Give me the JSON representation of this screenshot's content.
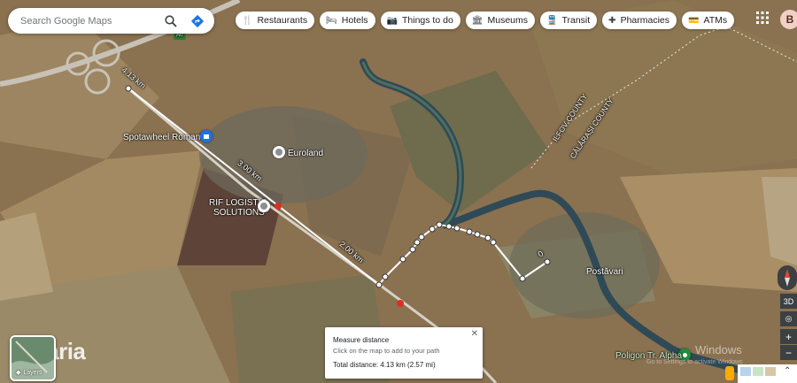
{
  "search": {
    "placeholder": "Search Google Maps"
  },
  "chips": [
    {
      "icon": "restaurant-icon",
      "glyph": "🍴",
      "label": "Restaurants"
    },
    {
      "icon": "hotel-icon",
      "glyph": "🛏",
      "label": "Hotels"
    },
    {
      "icon": "camera-icon",
      "glyph": "📷",
      "label": "Things to do"
    },
    {
      "icon": "museum-icon",
      "glyph": "🏛",
      "label": "Museums"
    },
    {
      "icon": "transit-icon",
      "glyph": "🚆",
      "label": "Transit"
    },
    {
      "icon": "pharmacy-icon",
      "glyph": "✚",
      "label": "Pharmacies"
    },
    {
      "icon": "atm-icon",
      "glyph": "💳",
      "label": "ATMs"
    }
  ],
  "user": {
    "avatar_letter": "B"
  },
  "map": {
    "places": {
      "spotawheel": "Spotawheel Romania",
      "euroland": "Euroland",
      "rif_line1": "RIF LOGISTIC",
      "rif_line2": "SOLUTIONS",
      "postavari": "Postăvari",
      "poligon": "Poligon Tr. Alpha"
    },
    "county_ilfov": "ILFOV COUNTY",
    "county_calarasi": "CĂLĂRAȘI COUNTY",
    "distance_labels": {
      "d1": "4.13 km",
      "d2": "3.00 km",
      "d3": "2.00 km",
      "d4": "0"
    },
    "road_shield": "A0"
  },
  "measure": {
    "title": "Measure distance",
    "hint": "Click on the map to add to your path",
    "total": "Total distance: 4.13 km (2.57 mi)"
  },
  "layers": {
    "label": "Layers"
  },
  "watermark": {
    "brand": "staria",
    "windows": "Windows",
    "windows_sub": "Go to Settings to activate Windows"
  },
  "controls": {
    "three_d": "3D",
    "zoom_in": "+",
    "zoom_out": "−"
  },
  "colors": {
    "route_line": "#ffffff",
    "water": "#2f4a56",
    "accent_blue": "#1a73e8"
  }
}
